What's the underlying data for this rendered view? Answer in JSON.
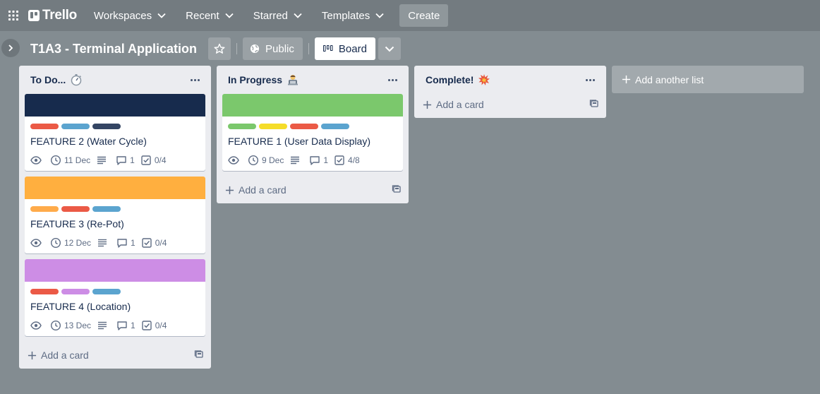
{
  "colors": {
    "board_bg": "#838c91",
    "nav_bg": "#737b80",
    "label_red": "#eb5a46",
    "label_blue": "#5ba4cf",
    "label_navy": "#344563",
    "label_orange": "#ffab4a",
    "label_green": "#7bc86c",
    "label_yellow": "#f5dd29",
    "label_purple": "#cd8de5",
    "cover_navy": "#172b4d",
    "cover_orange": "#ffaf3f",
    "cover_purple": "#cd8de5",
    "cover_green": "#7bc86c"
  },
  "nav": {
    "logo": "Trello",
    "items": [
      {
        "label": "Workspaces"
      },
      {
        "label": "Recent"
      },
      {
        "label": "Starred"
      },
      {
        "label": "Templates"
      }
    ],
    "create_label": "Create"
  },
  "board": {
    "title": "T1A3 - Terminal Application",
    "visibility_label": "Public",
    "view_label": "Board"
  },
  "lists": [
    {
      "title": "To Do...",
      "title_icon": "stopwatch-icon",
      "add_card_label": "Add a card",
      "cards": [
        {
          "title": "FEATURE 2 (Water Cycle)",
          "cover": "cover_navy",
          "labels": [
            "label_red",
            "label_blue",
            "label_navy"
          ],
          "due": "11 Dec",
          "comments": "1",
          "checklist": "0/4"
        },
        {
          "title": "FEATURE 3 (Re-Pot)",
          "cover": "cover_orange",
          "labels": [
            "label_orange",
            "label_red",
            "label_blue"
          ],
          "due": "12 Dec",
          "comments": "1",
          "checklist": "0/4"
        },
        {
          "title": "FEATURE 4 (Location)",
          "cover": "cover_purple",
          "labels": [
            "label_red",
            "label_purple",
            "label_blue"
          ],
          "due": "13 Dec",
          "comments": "1",
          "checklist": "0/4"
        }
      ]
    },
    {
      "title": "In Progress",
      "title_icon": "technologist-icon",
      "add_card_label": "Add a card",
      "cards": [
        {
          "title": "FEATURE 1 (User Data Display)",
          "cover": "cover_green",
          "labels": [
            "label_green",
            "label_yellow",
            "label_red",
            "label_blue"
          ],
          "due": "9 Dec",
          "comments": "1",
          "checklist": "4/8"
        }
      ]
    },
    {
      "title": "Complete!",
      "title_icon": "collision-icon",
      "add_card_label": "Add a card",
      "cards": []
    }
  ],
  "add_list_label": "Add another list"
}
